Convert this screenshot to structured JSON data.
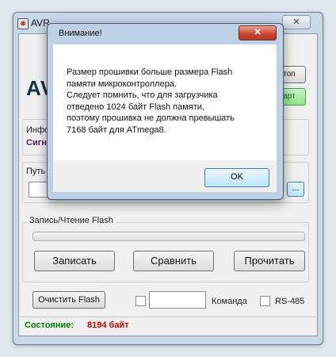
{
  "window": {
    "title": "AVR",
    "icon_name": "app-icon",
    "close_glyph": "✕"
  },
  "header": {
    "logo_text": "AV",
    "right_button_label": "топ",
    "green_button_label": "арт"
  },
  "info": {
    "label": "Инфор",
    "signal_text": "Сигн"
  },
  "path": {
    "label": "Путь",
    "browse_label": "..."
  },
  "flash": {
    "group_label": "Запись/Чтение Flash",
    "progress": 0,
    "write_label": "Записать",
    "compare_label": "Сравнить",
    "read_label": "Прочитать"
  },
  "bottom": {
    "clear_label": "Очистить Flash",
    "command_value": "",
    "command_label": "Команда",
    "rs485_label": "RS-485"
  },
  "status": {
    "label": "Состояние:",
    "value": "8194 байт",
    "label_color": "#008000",
    "value_color": "#cc0000"
  },
  "dialog": {
    "title": "Внимание!",
    "close_glyph": "✕",
    "lines": [
      "Размер прошивки больше размера Flash",
      "памяти микроконтроллера.",
      "Следует помнить, что для загрузчика",
      "отведено 1024 байт Flash памяти,",
      "поэтому прошивка не должна превышать",
      "7168 байт для ATmega8."
    ],
    "ok_label": "OK"
  }
}
